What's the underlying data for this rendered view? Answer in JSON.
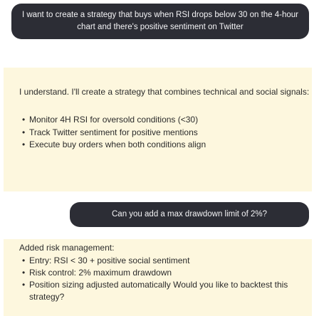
{
  "chat": {
    "user_message_1": "I want to create a strategy that buys when RSI drops below 30 on the 4-hour chart and there's positive sentiment on Twitter",
    "assistant_reply_1": {
      "intro": "I understand. I'll create a strategy that combines technical and social signals:",
      "points": [
        "Monitor 4H RSI for oversold conditions (<30)",
        "Track Twitter sentiment for positive mentions",
        "Execute buy orders when both conditions align"
      ]
    },
    "user_message_2": "Can you add a max drawdown limit of 2%?",
    "assistant_reply_2": {
      "intro": "Added risk management:",
      "points": [
        "Entry: RSI < 30 + positive social sentiment",
        "Risk control: 2% maximum drawdown",
        "Position sizing adjusted automatically Would you like to backtest this strategy?"
      ]
    }
  },
  "colors": {
    "user_bubble_bg": "#2c2d35",
    "assistant_bg": "#fdf7de"
  }
}
